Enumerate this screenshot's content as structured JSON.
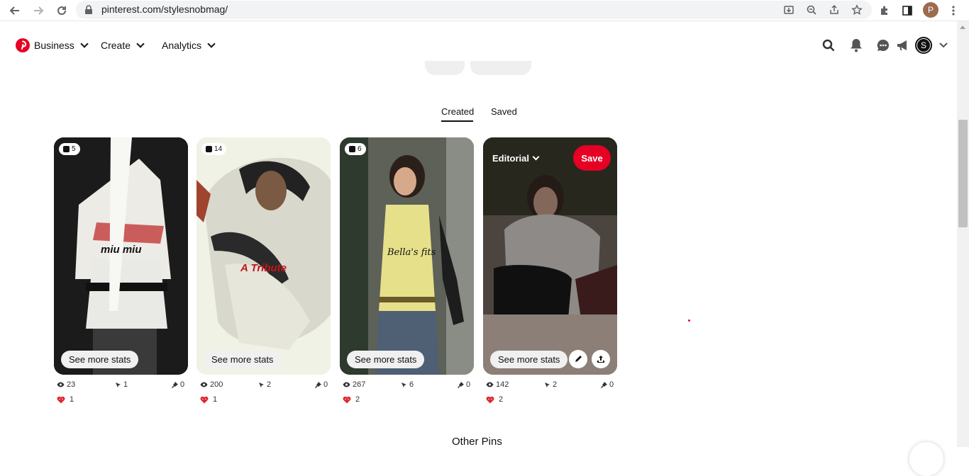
{
  "browser": {
    "url": "pinterest.com/stylesnobmag/",
    "profile_initial": "P"
  },
  "header": {
    "menu": [
      {
        "label": "Business"
      },
      {
        "label": "Create"
      },
      {
        "label": "Analytics"
      }
    ],
    "account_initial": "S"
  },
  "tabs": {
    "created": "Created",
    "saved": "Saved"
  },
  "pins": [
    {
      "badge_count": "5",
      "overlay_text": "miu miu",
      "stats_label": "See more stats",
      "views": "23",
      "clicks": "1",
      "saves": "0",
      "reactions": "1"
    },
    {
      "badge_count": "14",
      "overlay_text": "A Tribute",
      "stats_label": "See more stats",
      "views": "200",
      "clicks": "2",
      "saves": "0",
      "reactions": "1"
    },
    {
      "badge_count": "6",
      "overlay_text": "Bella's fits",
      "stats_label": "See more stats",
      "views": "267",
      "clicks": "6",
      "saves": "0",
      "reactions": "2"
    },
    {
      "board_label": "Editorial",
      "save_label": "Save",
      "stats_label": "See more stats",
      "views": "142",
      "clicks": "2",
      "saves": "0",
      "reactions": "2"
    }
  ],
  "section": {
    "other_pins": "Other Pins"
  },
  "colors": {
    "brand": "#e60023"
  }
}
